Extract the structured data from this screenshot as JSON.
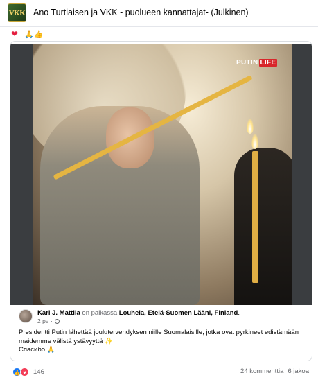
{
  "group": {
    "logo_text": "VKK",
    "title": "Ano Turtiaisen ja VKK - puolueen kannattajat- (Julkinen)"
  },
  "top_reactions": {
    "first": "❤",
    "second": "🙏👍"
  },
  "photo": {
    "watermark_main": "PUTIN",
    "watermark_accent": "LIFE"
  },
  "post": {
    "author": "Kari J. Mattila",
    "location_prefix": "on paikassa",
    "location": "Louhela, Etelä-Suomen Lääni, Finland",
    "location_suffix": ".",
    "age": "2 pv",
    "separator": "·",
    "body_line1": "Presidentti Putin lähettää joulutervehdyksen niille Suomalaisille, jotka ovat pyrkineet edistämään maidemme välistä ystävyyttä ✨",
    "body_line2": "Спасибо 🙏"
  },
  "footer": {
    "reaction_count": "146",
    "comments": "24 kommenttia",
    "shares": "6 jakoa"
  },
  "icons": {
    "like": "👍",
    "love": "♥"
  },
  "colors": {
    "facebook_blue": "#1877f2",
    "love_red": "#f33e58",
    "watermark_red": "#d8262b"
  }
}
